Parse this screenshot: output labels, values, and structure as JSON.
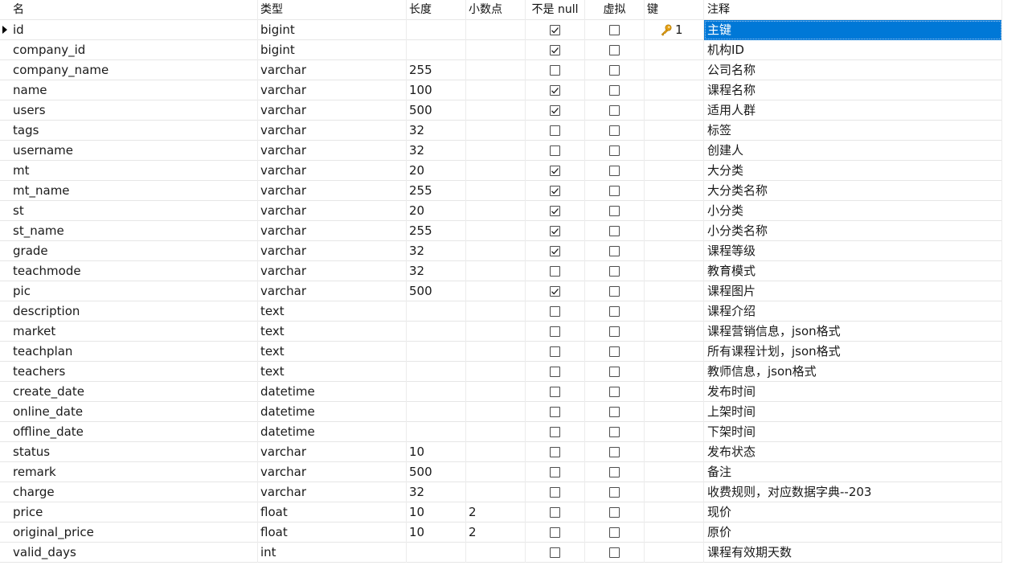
{
  "headers": {
    "name": "名",
    "type": "类型",
    "length": "长度",
    "decimals": "小数点",
    "not_null": "不是 null",
    "virtual": "虚拟",
    "key": "键",
    "comment": "注释"
  },
  "colors": {
    "selection": "#0078d7",
    "key_icon": "#e8a317"
  },
  "rows": [
    {
      "name": "id",
      "type": "bigint",
      "length": "",
      "decimals": "",
      "not_null": true,
      "virtual": false,
      "key": "1",
      "comment": "主键"
    },
    {
      "name": "company_id",
      "type": "bigint",
      "length": "",
      "decimals": "",
      "not_null": true,
      "virtual": false,
      "key": "",
      "comment": "机构ID"
    },
    {
      "name": "company_name",
      "type": "varchar",
      "length": "255",
      "decimals": "",
      "not_null": false,
      "virtual": false,
      "key": "",
      "comment": "公司名称"
    },
    {
      "name": "name",
      "type": "varchar",
      "length": "100",
      "decimals": "",
      "not_null": true,
      "virtual": false,
      "key": "",
      "comment": "课程名称"
    },
    {
      "name": "users",
      "type": "varchar",
      "length": "500",
      "decimals": "",
      "not_null": true,
      "virtual": false,
      "key": "",
      "comment": "适用人群"
    },
    {
      "name": "tags",
      "type": "varchar",
      "length": "32",
      "decimals": "",
      "not_null": false,
      "virtual": false,
      "key": "",
      "comment": "标签"
    },
    {
      "name": "username",
      "type": "varchar",
      "length": "32",
      "decimals": "",
      "not_null": false,
      "virtual": false,
      "key": "",
      "comment": "创建人"
    },
    {
      "name": "mt",
      "type": "varchar",
      "length": "20",
      "decimals": "",
      "not_null": true,
      "virtual": false,
      "key": "",
      "comment": "大分类"
    },
    {
      "name": "mt_name",
      "type": "varchar",
      "length": "255",
      "decimals": "",
      "not_null": true,
      "virtual": false,
      "key": "",
      "comment": "大分类名称"
    },
    {
      "name": "st",
      "type": "varchar",
      "length": "20",
      "decimals": "",
      "not_null": true,
      "virtual": false,
      "key": "",
      "comment": "小分类"
    },
    {
      "name": "st_name",
      "type": "varchar",
      "length": "255",
      "decimals": "",
      "not_null": true,
      "virtual": false,
      "key": "",
      "comment": "小分类名称"
    },
    {
      "name": "grade",
      "type": "varchar",
      "length": "32",
      "decimals": "",
      "not_null": true,
      "virtual": false,
      "key": "",
      "comment": "课程等级"
    },
    {
      "name": "teachmode",
      "type": "varchar",
      "length": "32",
      "decimals": "",
      "not_null": false,
      "virtual": false,
      "key": "",
      "comment": "教育模式"
    },
    {
      "name": "pic",
      "type": "varchar",
      "length": "500",
      "decimals": "",
      "not_null": true,
      "virtual": false,
      "key": "",
      "comment": "课程图片"
    },
    {
      "name": "description",
      "type": "text",
      "length": "",
      "decimals": "",
      "not_null": false,
      "virtual": false,
      "key": "",
      "comment": "课程介绍"
    },
    {
      "name": "market",
      "type": "text",
      "length": "",
      "decimals": "",
      "not_null": false,
      "virtual": false,
      "key": "",
      "comment": "课程营销信息，json格式"
    },
    {
      "name": "teachplan",
      "type": "text",
      "length": "",
      "decimals": "",
      "not_null": false,
      "virtual": false,
      "key": "",
      "comment": "所有课程计划，json格式"
    },
    {
      "name": "teachers",
      "type": "text",
      "length": "",
      "decimals": "",
      "not_null": false,
      "virtual": false,
      "key": "",
      "comment": "教师信息，json格式"
    },
    {
      "name": "create_date",
      "type": "datetime",
      "length": "",
      "decimals": "",
      "not_null": false,
      "virtual": false,
      "key": "",
      "comment": "发布时间"
    },
    {
      "name": "online_date",
      "type": "datetime",
      "length": "",
      "decimals": "",
      "not_null": false,
      "virtual": false,
      "key": "",
      "comment": "上架时间"
    },
    {
      "name": "offline_date",
      "type": "datetime",
      "length": "",
      "decimals": "",
      "not_null": false,
      "virtual": false,
      "key": "",
      "comment": "下架时间"
    },
    {
      "name": "status",
      "type": "varchar",
      "length": "10",
      "decimals": "",
      "not_null": false,
      "virtual": false,
      "key": "",
      "comment": "发布状态"
    },
    {
      "name": "remark",
      "type": "varchar",
      "length": "500",
      "decimals": "",
      "not_null": false,
      "virtual": false,
      "key": "",
      "comment": "备注"
    },
    {
      "name": "charge",
      "type": "varchar",
      "length": "32",
      "decimals": "",
      "not_null": false,
      "virtual": false,
      "key": "",
      "comment": "收费规则，对应数据字典--203"
    },
    {
      "name": "price",
      "type": "float",
      "length": "10",
      "decimals": "2",
      "not_null": false,
      "virtual": false,
      "key": "",
      "comment": "现价"
    },
    {
      "name": "original_price",
      "type": "float",
      "length": "10",
      "decimals": "2",
      "not_null": false,
      "virtual": false,
      "key": "",
      "comment": "原价"
    },
    {
      "name": "valid_days",
      "type": "int",
      "length": "",
      "decimals": "",
      "not_null": false,
      "virtual": false,
      "key": "",
      "comment": "课程有效期天数"
    }
  ],
  "selected_row": 0
}
